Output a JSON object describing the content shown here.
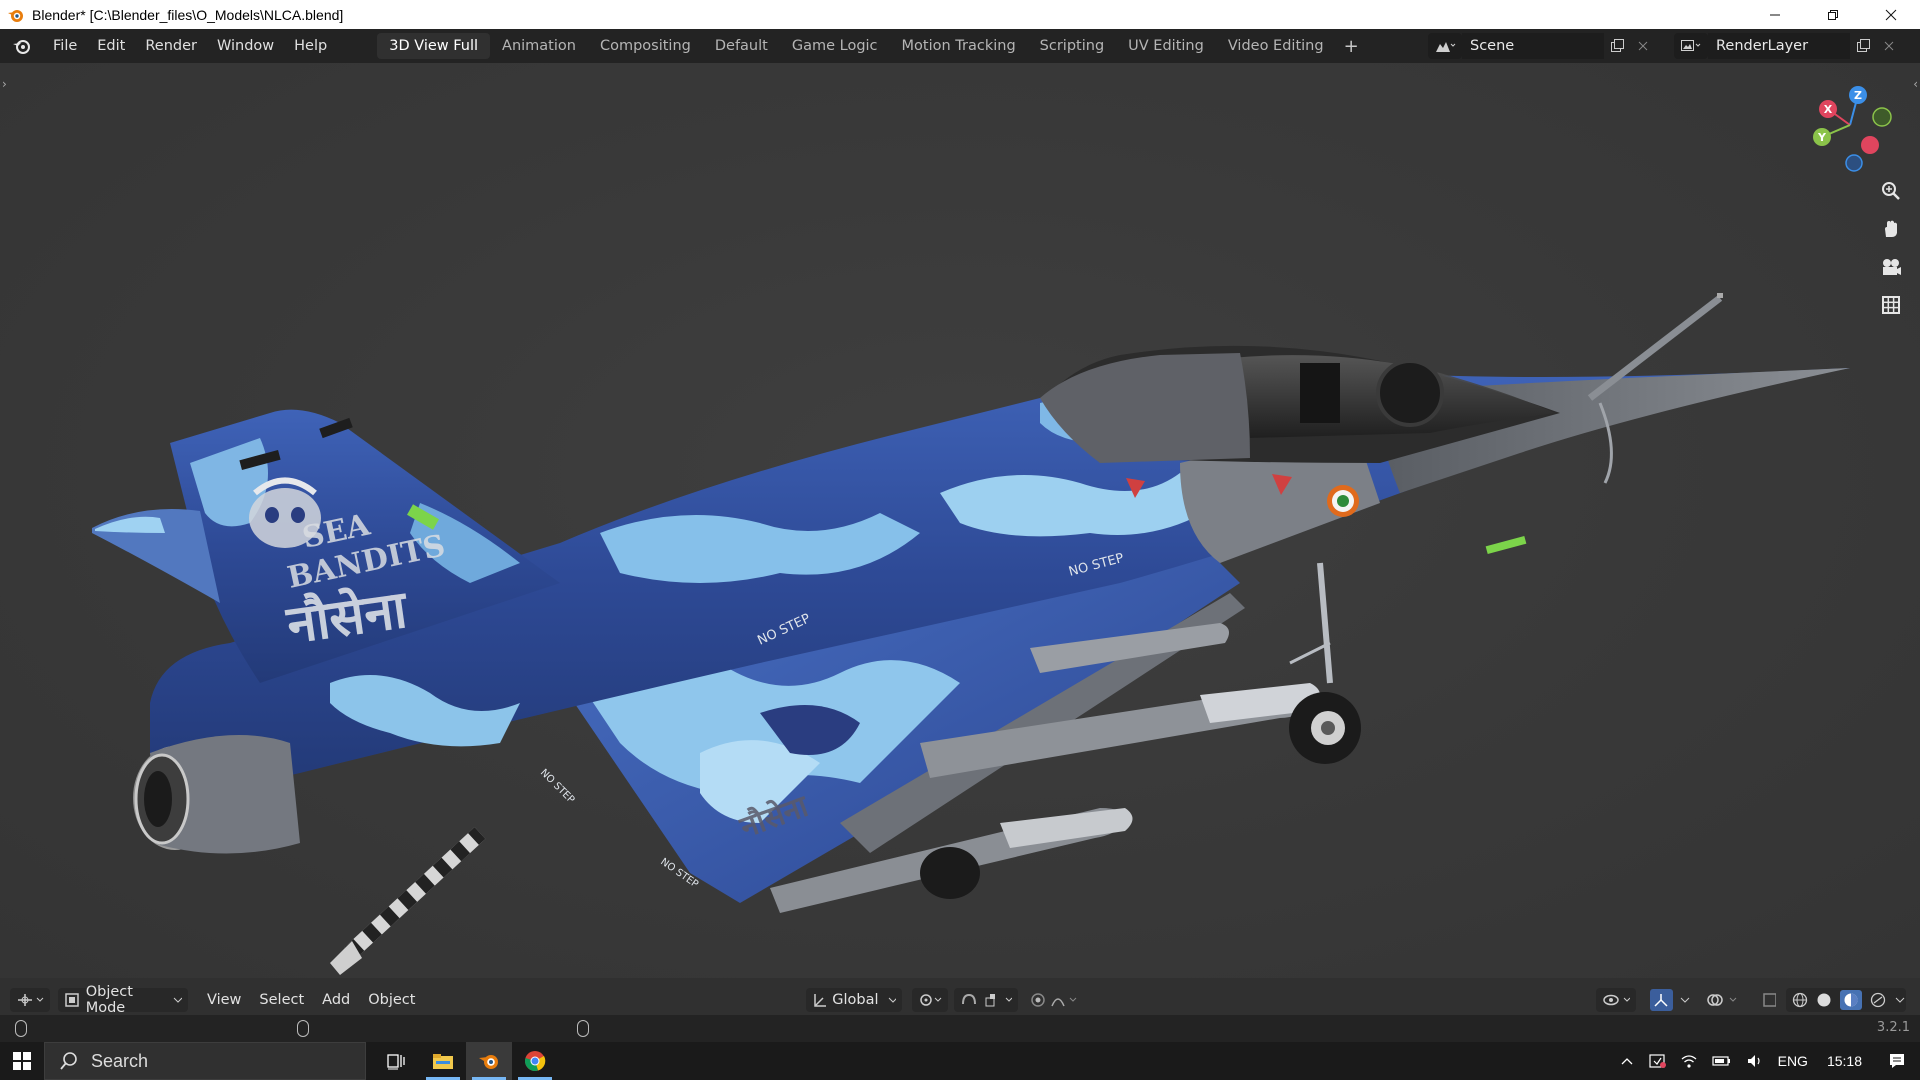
{
  "window": {
    "title": "Blender* [C:\\Blender_files\\O_Models\\NLCA.blend]",
    "minimize_icon": "minimize-icon",
    "maximize_icon": "restore-icon",
    "close_icon": "close-icon"
  },
  "menu": {
    "items": [
      "File",
      "Edit",
      "Render",
      "Window",
      "Help"
    ]
  },
  "workspaces": {
    "tabs": [
      "3D View Full",
      "Animation",
      "Compositing",
      "Default",
      "Game Logic",
      "Motion Tracking",
      "Scripting",
      "UV Editing",
      "Video Editing"
    ],
    "active": "3D View Full",
    "add_label": "+"
  },
  "scene": {
    "name": "Scene",
    "render_layer": "RenderLayer"
  },
  "viewport": {
    "background": "#393939",
    "gizmo_axes": {
      "x": "X",
      "y": "Y",
      "z": "Z"
    },
    "axis_colors": {
      "x": "#e0455e",
      "y": "#8bc34a",
      "z": "#3b8fe8"
    },
    "decals": {
      "tail_top": "SEA",
      "tail_bottom": "BANDITS",
      "tail_hindi": "नौसेना",
      "wing_hindi": "नौसेना",
      "no_step_1": "NO STEP",
      "no_step_2": "NO STEP",
      "no_step_3": "NO STEP",
      "no_step_4": "NO STEP"
    },
    "camo_colors": [
      "#2b3f86",
      "#3b5fb5",
      "#7ab6e6",
      "#a9d8f5"
    ]
  },
  "header": {
    "mode": "Object Mode",
    "menus": [
      "View",
      "Select",
      "Add",
      "Object"
    ],
    "transform_orientation": "Global"
  },
  "status": {
    "version": "3.2.1"
  },
  "taskbar": {
    "search_placeholder": "Search",
    "language": "ENG",
    "time": "15:18"
  }
}
